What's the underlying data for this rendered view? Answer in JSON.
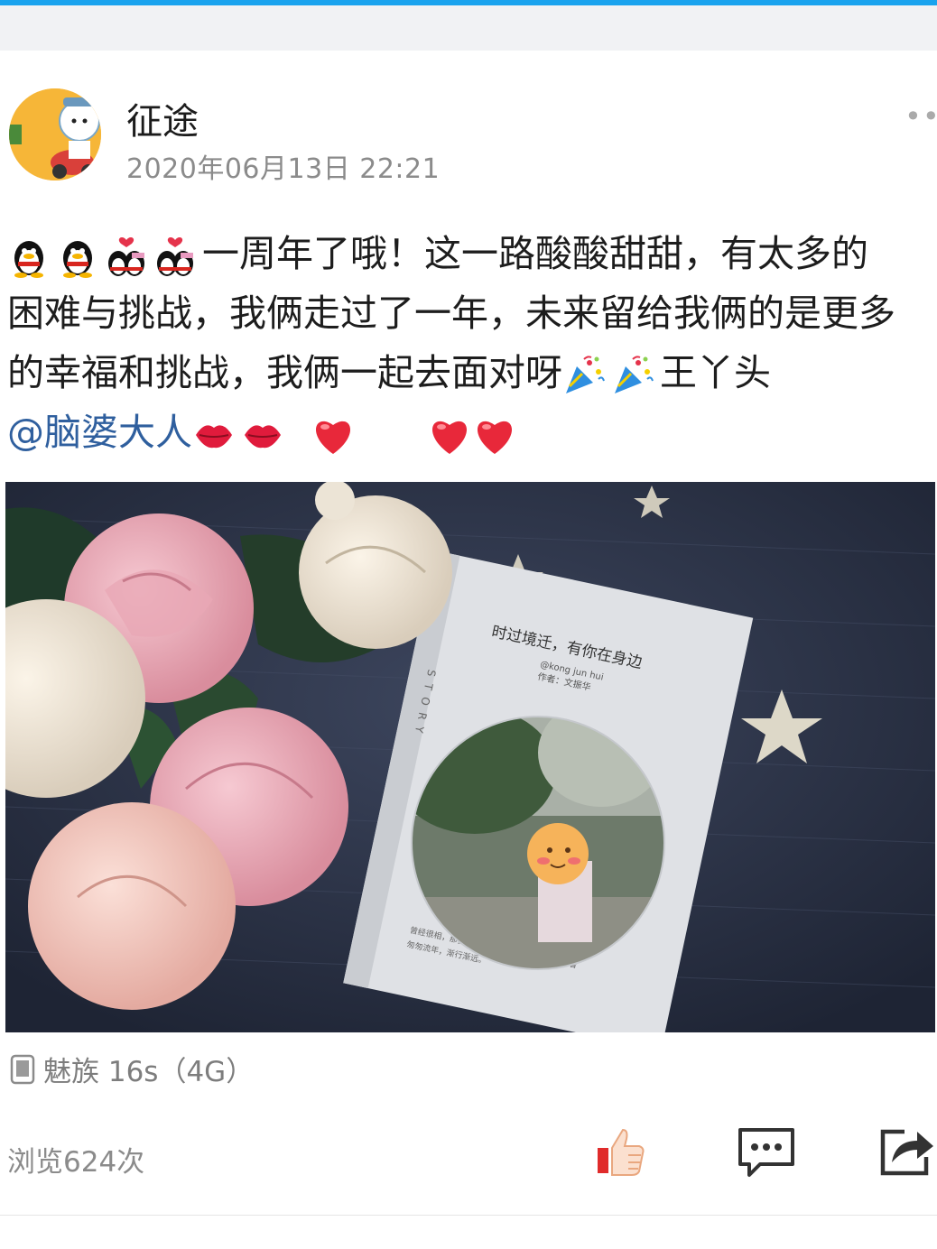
{
  "post": {
    "username": "征途",
    "timestamp": "2020年06月13日 22:21",
    "more": "•••",
    "line1_text": "一周年了哦！这一路酸酸甜甜，有太多的",
    "line2_text": "困难与挑战，我俩走过了一年，未来留给我俩的是更多",
    "line3_text": "的幸福和挑战，我俩一起去面对呀",
    "line3_tail": "王丫头",
    "mention": "@脑婆大人",
    "photo": {
      "book_title": "时过境迁，有你在身边",
      "book_sub1": "@kong jun hui",
      "book_sub2": "作者：文振华",
      "book_spine": "STORY",
      "book_desc1": "曾经很相，那多年后只剩回忆，那你在何处等着",
      "book_desc2": "匆匆流年，渐行渐远。"
    },
    "device": "魅族 16s（4G）",
    "views": "浏览624次"
  },
  "colors": {
    "accent": "#1aa3ee",
    "mention": "#2f5f9e",
    "muted": "#8b8b8b",
    "like_red": "#e02b2b"
  },
  "icons": {
    "penguin": "qq-penguin-icon",
    "couple": "kissing-couple-icon",
    "party": "party-popper-icon",
    "lips": "lips-icon",
    "heart": "red-heart-icon",
    "like": "thumbs-up-icon",
    "comment": "comment-icon",
    "share": "share-icon",
    "device": "phone-icon"
  }
}
